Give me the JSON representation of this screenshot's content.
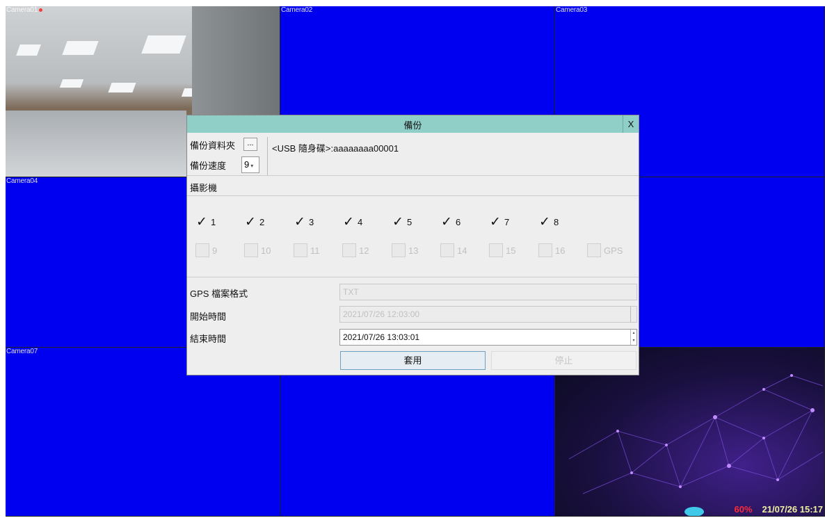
{
  "cameras": [
    {
      "label": "Camera01"
    },
    {
      "label": "Camera02"
    },
    {
      "label": "Camera03"
    },
    {
      "label": "Camera04"
    },
    {
      "label": "Camera07"
    }
  ],
  "status_bar": {
    "percent": "60%",
    "datetime": "21/07/26 15:17"
  },
  "dialog": {
    "title": "備份",
    "close_label": "X",
    "folder_label": "備份資料夾",
    "browse_label": "...",
    "path_value": "<USB 隨身碟>:aaaaaaaa00001",
    "speed_label": "備份速度",
    "speed_value": "9",
    "camera_section_label": "攝影機",
    "channels_checked": [
      "1",
      "2",
      "3",
      "4",
      "5",
      "6",
      "7",
      "8"
    ],
    "channels_unchecked": [
      "9",
      "10",
      "11",
      "12",
      "13",
      "14",
      "15",
      "16",
      "GPS"
    ],
    "gps_format_label": "GPS 檔案格式",
    "gps_format_value": "TXT",
    "start_time_label": "開始時間",
    "start_time_value": "2021/07/26 12:03:00",
    "end_time_label": "結束時間",
    "end_time_value": "2021/07/26 13:03:01",
    "apply_label": "套用",
    "stop_label": "停止"
  }
}
